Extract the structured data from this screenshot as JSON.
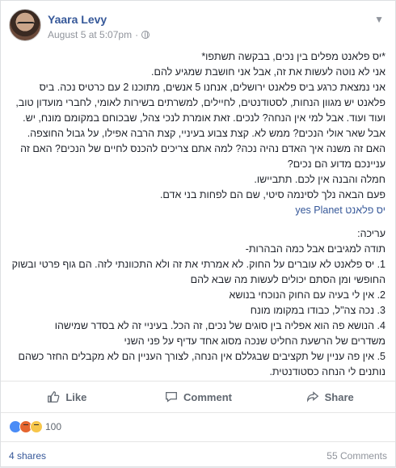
{
  "post": {
    "author": "Yaara Levy",
    "timestamp": "August 5 at 5:07pm",
    "paragraphs": [
      "*יס פלאנט מפלים בין נכים, בבקשה תשתפו*",
      "אני לא נוטה לעשות את זה, אבל אני חושבת שמגיע להם.",
      "אני נמצאת כרגע ביס פלאנט ירושלים, אנחנו 5 אנשים, מתוכנו 2 עם כרטיס נכה. ביס",
      "פלאנט יש מגוון הנחות, לסטודנטים, לחיילים, למשרתים בשירות לאומי, לחברי מועדון טוב,",
      "ועוד ועוד. אבל למי אין הנחה? לנכים. זאת אומרת לנכי צהל, שבכוחם במקומם מונח, יש.",
      "אבל שאר אולי הנכים? ממש לא. קצת צבוע בעיניי, קצת הרבה אפילו, על גבול החוצפה.",
      "האם זה משנה איך האדם נהיה נכה? למה אתם צריכים להכנס לחיים של הנכים? האם זה",
      "עניינכם מדוע הם נכים?",
      "חמלה והבנה אין לכם. תתביישו.",
      "פעם הבאה נלך לסינמה סיטי, שם הם לפחות בני אדם."
    ],
    "tag": "יס פלאנט yes Planet",
    "edit_header": "עריכה:",
    "edit_intro": "תודה למגיבים אבל כמה הבהרות-",
    "edit_points": [
      "1. יס פלאנט לא עוברים על החוק. לא אמרתי את זה ולא התכוונתי לזה. הם גוף פרטי ובשוק",
      "החופשי ומן הסתם יכולים לעשות מה שבא להם",
      "2. אין לי בעיה עם החוק הנוכחי בנושא",
      "3. נכה צה\"ל, כבודו במקומו מונח",
      "4. הנושא פה הוא אפליה בין סוגים של נכים, זה הכל. בעיניי זה לא בסדר שמישהו",
      "משדרים של הרשעת החליט שנכה מסוג אחד עדיף על פני השני",
      "5. אין פה עניין של תקציבים שבגללם אין הנחה, לצורך העניין הם לא מקבלים החזר כשהם",
      "נותנים לי הנחה כסטודנטית."
    ]
  },
  "actions": {
    "like": "Like",
    "comment": "Comment",
    "share": "Share"
  },
  "reactions": {
    "count": "100"
  },
  "footer": {
    "shares": "4 shares",
    "comments": "55 Comments"
  }
}
